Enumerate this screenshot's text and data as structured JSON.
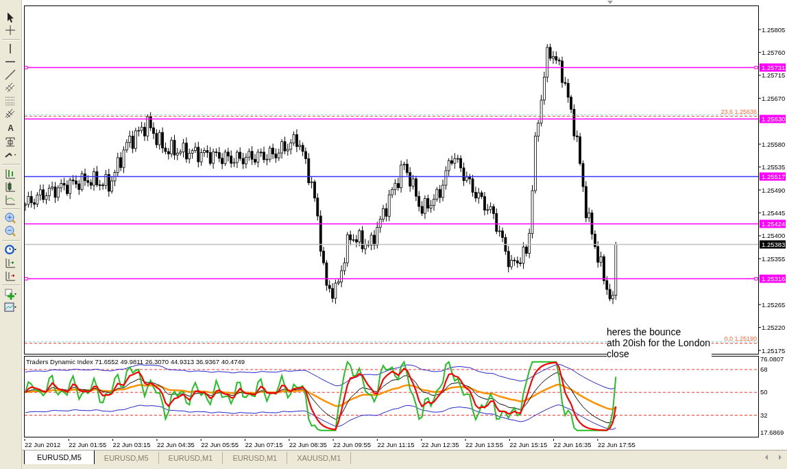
{
  "toolbar": {
    "text_tool": "A"
  },
  "price_chart": {
    "price_axis": [
      "1.25805",
      "1.25760",
      "1.25715",
      "1.25670",
      "1.25580",
      "1.25535",
      "1.25490",
      "1.25445",
      "1.25400",
      "1.25355",
      "1.25265",
      "1.25220",
      "1.25175"
    ],
    "levels": [
      {
        "kind": "line",
        "label": "1.25731",
        "color": "#ff00ff",
        "selected": true
      },
      {
        "kind": "fibo",
        "label": "23.6 1.25636"
      },
      {
        "kind": "line",
        "label": "1.25630",
        "color": "#ff00ff",
        "selected": false
      },
      {
        "kind": "line",
        "label": "1.25517",
        "color": "#3333ff",
        "selected": false
      },
      {
        "kind": "line",
        "label": "1.25424",
        "color": "#ff00ff",
        "selected": false
      },
      {
        "kind": "current",
        "label": "1.25383"
      },
      {
        "kind": "line",
        "label": "1.25316",
        "color": "#ff00ff",
        "selected": true
      },
      {
        "kind": "fibo",
        "label": "0.0 1.25190"
      }
    ],
    "annotation": {
      "lines": [
        "heres the bounce",
        "ath 20ish for the London",
        "close"
      ]
    }
  },
  "indicator": {
    "title": "Traders Dynamic Index 71.6552 49.9811 26.3070 44.9313 36.9367 40.4749",
    "axis": [
      "76.0807",
      "68",
      "50",
      "32",
      "17.6869"
    ]
  },
  "time_axis": [
    "22 Jun 2012",
    "22 Jun 01:55",
    "22 Jun 03:15",
    "22 Jun 04:35",
    "22 Jun 05:55",
    "22 Jun 07:15",
    "22 Jun 08:35",
    "22 Jun 09:55",
    "22 Jun 11:15",
    "22 Jun 12:35",
    "22 Jun 13:55",
    "22 Jun 15:15",
    "22 Jun 16:35",
    "22 Jun 17:55"
  ],
  "tabs": [
    {
      "label": "EURUSD,M5",
      "selected": true
    },
    {
      "label": "EURUSD,M5",
      "selected": false
    },
    {
      "label": "EURUSD,M1",
      "selected": false
    },
    {
      "label": "EURUSD,M1",
      "selected": false
    },
    {
      "label": "XAUUSD,M1",
      "selected": false
    }
  ]
}
